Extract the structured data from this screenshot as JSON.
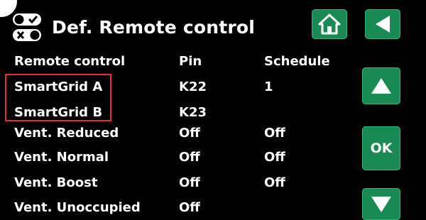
{
  "header": {
    "title": "Def. Remote control",
    "icon": "remote-control-switches-icon"
  },
  "nav": {
    "home_icon": "home-icon",
    "back_icon": "back-arrow-icon",
    "up_icon": "up-arrow-icon",
    "down_icon": "down-arrow-icon",
    "ok_label": "OK"
  },
  "table": {
    "columns": [
      "Remote control",
      "Pin",
      "Schedule"
    ],
    "rows": [
      {
        "name": "SmartGrid A",
        "pin": "K22",
        "schedule": "1"
      },
      {
        "name": "SmartGrid B",
        "pin": "K23",
        "schedule": ""
      },
      {
        "name": "Vent. Reduced",
        "pin": "Off",
        "schedule": "Off"
      },
      {
        "name": "Vent. Normal",
        "pin": "Off",
        "schedule": "Off"
      },
      {
        "name": "Vent. Boost",
        "pin": "Off",
        "schedule": "Off"
      },
      {
        "name": "Vent. Unoccupied",
        "pin": "Off",
        "schedule": ""
      }
    ]
  },
  "colors": {
    "background": "#000000",
    "button": "#1a8a55",
    "text": "#ffffff",
    "highlight": "#e03030"
  }
}
